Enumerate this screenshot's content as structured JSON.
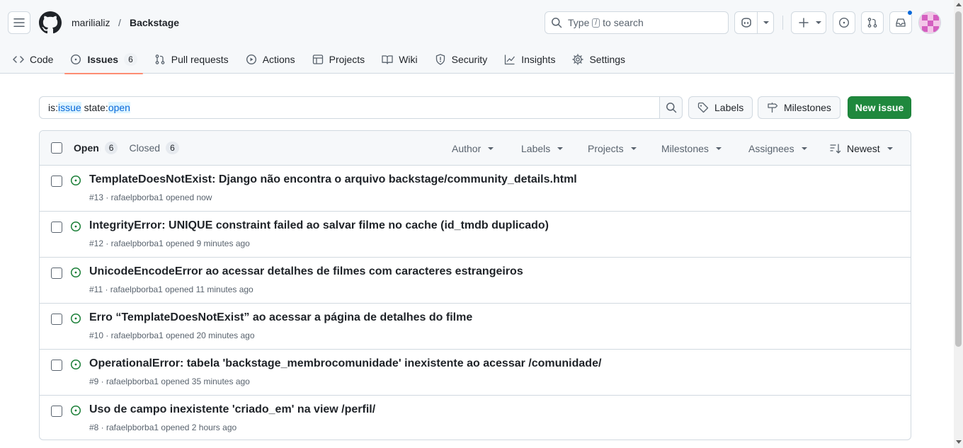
{
  "header": {
    "owner": "marilializ",
    "separator": "/",
    "repo": "Backstage",
    "search_text_before": "Type",
    "search_key": "/",
    "search_text_after": "to search"
  },
  "tabs": [
    {
      "label": "Code",
      "icon": "code-icon"
    },
    {
      "label": "Issues",
      "count": "6",
      "icon": "issue-opened-icon"
    },
    {
      "label": "Pull requests",
      "icon": "git-pull-request-icon"
    },
    {
      "label": "Actions",
      "icon": "play-icon"
    },
    {
      "label": "Projects",
      "icon": "table-icon"
    },
    {
      "label": "Wiki",
      "icon": "book-icon"
    },
    {
      "label": "Security",
      "icon": "shield-icon"
    },
    {
      "label": "Insights",
      "icon": "graph-icon"
    },
    {
      "label": "Settings",
      "icon": "gear-icon"
    }
  ],
  "filter": {
    "prefix1": "is:",
    "value1": "issue",
    "prefix2": " state:",
    "value2": "open"
  },
  "buttons": {
    "labels": "Labels",
    "milestones": "Milestones",
    "new_issue": "New issue"
  },
  "list": {
    "open_label": "Open",
    "open_count": "6",
    "closed_label": "Closed",
    "closed_count": "6",
    "filters": [
      "Author",
      "Labels",
      "Projects",
      "Milestones",
      "Assignees"
    ],
    "sort": "Newest"
  },
  "issues": [
    {
      "title": "TemplateDoesNotExist: Django não encontra o arquivo backstage/community_details.html",
      "meta": "#13 · rafaelpborba1 opened now"
    },
    {
      "title": "IntegrityError: UNIQUE constraint failed ao salvar filme no cache (id_tmdb duplicado)",
      "meta": "#12 · rafaelpborba1 opened 9 minutes ago"
    },
    {
      "title": "UnicodeEncodeError ao acessar detalhes de filmes com caracteres estrangeiros",
      "meta": "#11 · rafaelpborba1 opened 11 minutes ago"
    },
    {
      "title": "Erro “TemplateDoesNotExist” ao acessar a página de detalhes do filme",
      "meta": "#10 · rafaelpborba1 opened 20 minutes ago"
    },
    {
      "title": "OperationalError: tabela 'backstage_membrocomunidade' inexistente ao acessar /comunidade/",
      "meta": "#9 · rafaelpborba1 opened 35 minutes ago"
    },
    {
      "title": "Uso de campo inexistente 'criado_em' na view /perfil/",
      "meta": "#8 · rafaelpborba1 opened 2 hours ago"
    }
  ],
  "colors": {
    "accent_underline": "#fd8c73",
    "primary_button": "#1f883d",
    "open_issue_icon": "#1a7f37",
    "notification_dot": "#0969da"
  }
}
